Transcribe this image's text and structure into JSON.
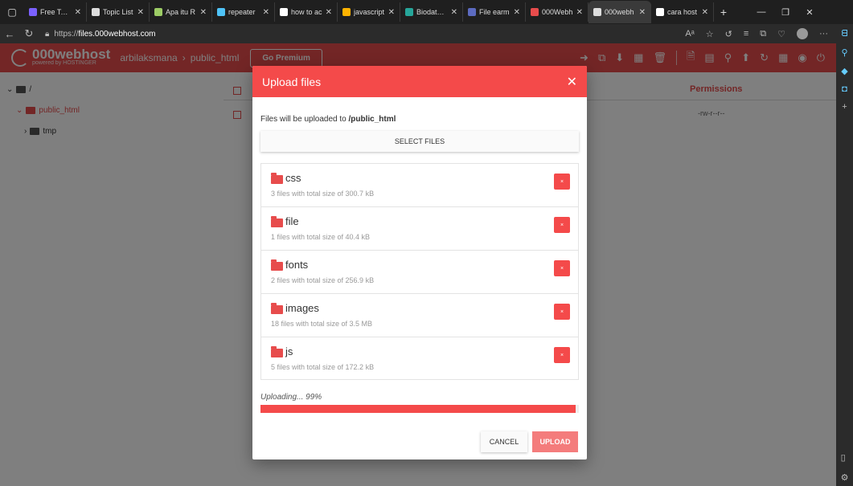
{
  "browser": {
    "tabs": [
      {
        "title": "Free Temp",
        "color": "#7b61ff"
      },
      {
        "title": "Topic List",
        "color": "#dddddd"
      },
      {
        "title": "Apa itu R",
        "color": "#9ccc65"
      },
      {
        "title": "repeater",
        "color": "#4fc3f7"
      },
      {
        "title": "how to ac",
        "color": "#ffffff"
      },
      {
        "title": "javascript",
        "color": "#ffb300"
      },
      {
        "title": "Biodata M",
        "color": "#26a69a"
      },
      {
        "title": "File earm",
        "color": "#5c6bc0"
      },
      {
        "title": "000Webh",
        "color": "#e74c4c"
      },
      {
        "title": "000webh",
        "color": "#dddddd"
      },
      {
        "title": "cara host",
        "color": "#ffffff"
      }
    ],
    "url_prefix": "https://",
    "url_host": "files.000webhost.com",
    "read_aloud": "Aᵃ",
    "more_label": "···"
  },
  "header": {
    "brand": "000webhost",
    "brand_sub": "powered by HOSTINGER",
    "breadcrumb_user": "arbilaksmana",
    "breadcrumb_dir": "public_html",
    "premium_label": "Go Premium"
  },
  "tree": {
    "root": "/",
    "items": [
      "public_html",
      "tmp"
    ]
  },
  "table": {
    "permissions_header": "Permissions",
    "permissions_value": "-rw-r--r--"
  },
  "modal": {
    "title": "Upload files",
    "dest_prefix": "Files will be uploaded to ",
    "dest_path": "/public_html",
    "select_label": "SELECT FILES",
    "files": [
      {
        "name": "css",
        "meta": "3 files with total size of 300.7 kB"
      },
      {
        "name": "file",
        "meta": "1 files with total size of 40.4 kB"
      },
      {
        "name": "fonts",
        "meta": "2 files with total size of 256.9 kB"
      },
      {
        "name": "images",
        "meta": "18 files with total size of 3.5 MB"
      },
      {
        "name": "js",
        "meta": "5 files with total size of 172.2 kB"
      }
    ],
    "delete_glyph": "×",
    "status": "Uploading... 99%",
    "progress": 0.99,
    "cancel_label": "CANCEL",
    "upload_label": "UPLOAD"
  },
  "colors": {
    "accent": "#f44a4a",
    "header": "#e74c4c"
  }
}
